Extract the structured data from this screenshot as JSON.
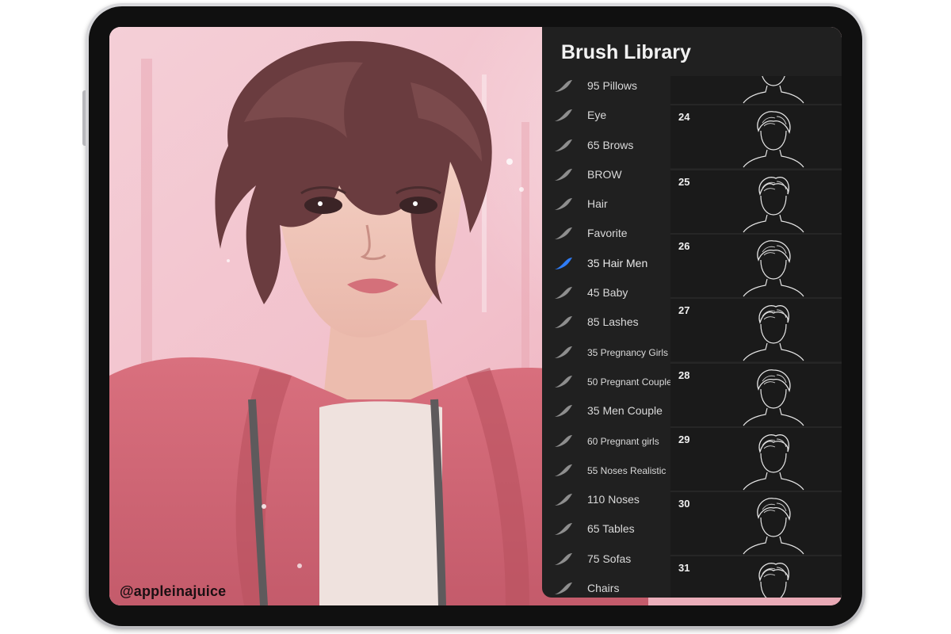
{
  "panel": {
    "title": "Brush Library",
    "sets": [
      {
        "label": "95 Pillows",
        "active": false
      },
      {
        "label": "Eye",
        "active": false
      },
      {
        "label": "65 Brows",
        "active": false
      },
      {
        "label": "BROW",
        "active": false
      },
      {
        "label": "Hair",
        "active": false
      },
      {
        "label": "Favorite",
        "active": false
      },
      {
        "label": "35 Hair Men",
        "active": true
      },
      {
        "label": "45 Baby",
        "active": false
      },
      {
        "label": "85 Lashes",
        "active": false
      },
      {
        "label": "35 Pregnancy Girls",
        "active": false
      },
      {
        "label": "50 Pregnant Couple",
        "active": false
      },
      {
        "label": "35 Men Couple",
        "active": false
      },
      {
        "label": "60 Pregnant girls",
        "active": false
      },
      {
        "label": "55 Noses Realistic",
        "active": false
      },
      {
        "label": "110 Noses",
        "active": false
      },
      {
        "label": "65 Tables",
        "active": false
      },
      {
        "label": "75 Sofas",
        "active": false
      },
      {
        "label": "Chairs",
        "active": false
      }
    ],
    "brushes": [
      {
        "number": ""
      },
      {
        "number": "24"
      },
      {
        "number": "25"
      },
      {
        "number": "26"
      },
      {
        "number": "27"
      },
      {
        "number": "28"
      },
      {
        "number": "29"
      },
      {
        "number": "30"
      },
      {
        "number": "31"
      }
    ]
  },
  "watermark": "@appleinajuice",
  "colors": {
    "active_brush_icon": "#2f7cf6",
    "brush_icon": "#8e8e8e",
    "panel_bg": "#202020"
  }
}
